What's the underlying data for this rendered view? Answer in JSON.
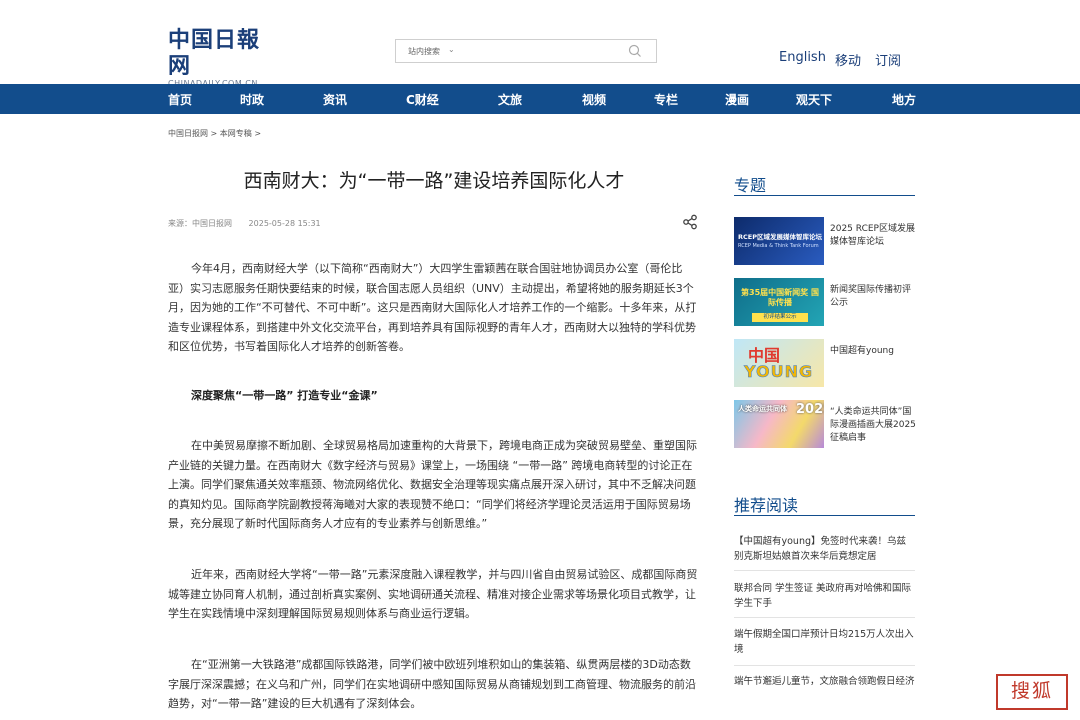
{
  "header": {
    "logo_cn": "中国日報网",
    "logo_en": "CHINADAILY.COM.CN",
    "search": {
      "scope": "站内搜索",
      "placeholder": ""
    },
    "links": [
      "English",
      "移动",
      "订阅"
    ]
  },
  "nav": [
    "首页",
    "时政",
    "资讯",
    "C财经",
    "文旅",
    "视频",
    "专栏",
    "漫画",
    "观天下",
    "地方"
  ],
  "breadcrumb": "中国日报网 > 本网专稿 >",
  "article": {
    "title": "西南财大：为“一带一路”建设培养国际化人才",
    "source": "来源：中国日报网",
    "datetime": "2025-05-28 15:31",
    "p1": "今年4月，西南财经大学（以下简称“西南财大”）大四学生雷颖茜在联合国驻地协调员办公室（哥伦比亚）实习志愿服务任期快要结束的时候，联合国志愿人员组织（UNV）主动提出，希望将她的服务期延长3个月，因为她的工作“不可替代、不可中断”。这只是西南财大国际化人才培养工作的一个缩影。十多年来，从打造专业课程体系，到搭建中外文化交流平台，再到培养具有国际视野的青年人才，西南财大以独特的学科优势和区位优势，书写着国际化人才培养的创新答卷。",
    "subhead": "深度聚焦“一带一路” 打造专业“金课”",
    "p2": "在中美贸易摩擦不断加剧、全球贸易格局加速重构的大背景下，跨境电商正成为突破贸易壁垒、重塑国际产业链的关键力量。在西南财大《数字经济与贸易》课堂上，一场围绕 “一带一路” 跨境电商转型的讨论正在上演。同学们聚焦通关效率瓶颈、物流网络优化、数据安全治理等现实痛点展开深入研讨，其中不乏解决问题的真知灼见。国际商学院副教授蒋海曦对大家的表现赞不绝口：“同学们将经济学理论灵活运用于国际贸易场景，充分展现了新时代国际商务人才应有的专业素养与创新思维。”",
    "p3": "近年来，西南财经大学将“一带一路”元素深度融入课程教学，并与四川省自由贸易试验区、成都国际商贸城等建立协同育人机制，通过剖析真实案例、实地调研通关流程、精准对接企业需求等场景化项目式教学，让学生在实践情境中深刻理解国际贸易规则体系与商业运行逻辑。",
    "p4": "在“亚洲第一大铁路港”成都国际铁路港，同学们被中欧班列堆积如山的集装箱、纵贯两层楼的3D动态数字展厅深深震撼；在义乌和广州，同学们在实地调研中感知国际贸易从商铺规划到工商管理、物流服务的前沿趋势，对“一带一路”建设的巨大机遇有了深刻体会。"
  },
  "sidebar": {
    "topics_heading": "专题",
    "topics": [
      {
        "title": "2025 RCEP区域发展媒体智库论坛",
        "thumb_text": "RCEP区域发展媒体智库论坛",
        "thumb_sub": "RCEP Media & Think Tank Forum"
      },
      {
        "title": "新闻奖国际传播初评公示",
        "thumb_text": "第35届中国新闻奖 国际传播",
        "thumb_sub": "初评结果公示"
      },
      {
        "title": "中国超有young",
        "thumb_text": "中国",
        "thumb_sub": "YOUNG"
      },
      {
        "title": "“人类命运共同体”国际漫画插画大展2025征稿启事",
        "thumb_text": "人类命运共同体",
        "thumb_sub": "2025"
      }
    ],
    "recommend_heading": "推荐阅读",
    "recommend": [
      "【中国超有young】免签时代来袭！乌兹别克斯坦姑娘首次来华后竟想定居",
      "联邦合同 学生签证 美政府再对哈佛和国际学生下手",
      "端午假期全国口岸预计日均215万人次出入境",
      "端午节邂逅儿童节，文旅融合领跑假日经济"
    ]
  },
  "watermark": "搜狐",
  "colors": {
    "brand_blue": "#124d8c",
    "text": "#333333",
    "stamp_red": "#c0392b"
  }
}
